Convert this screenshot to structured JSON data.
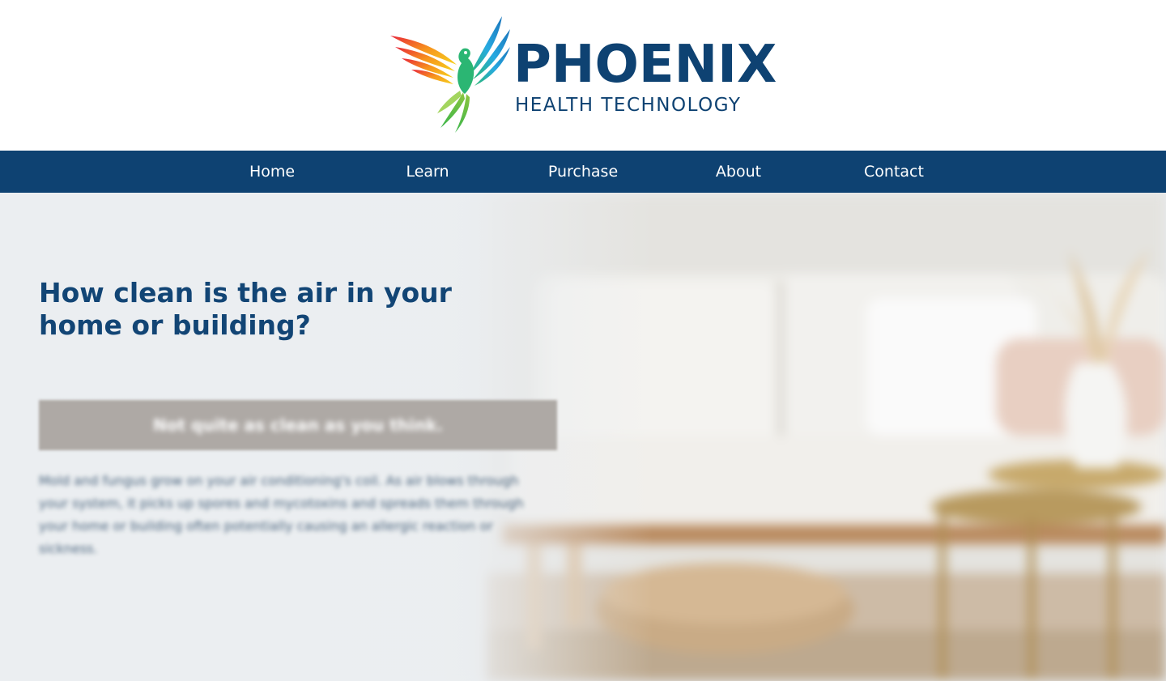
{
  "brand": {
    "title": "PHOENIX",
    "subtitle": "HEALTH TECHNOLOGY",
    "primary_color": "#0e4272",
    "logo_mark": "phoenix-bird-icon"
  },
  "nav": {
    "items": [
      {
        "label": "Home"
      },
      {
        "label": "Learn"
      },
      {
        "label": "Purchase"
      },
      {
        "label": "About"
      },
      {
        "label": "Contact"
      }
    ]
  },
  "hero": {
    "heading": "How clean is the air in your home or building?",
    "callout": "Not quite as clean as you think.",
    "callout_color": "#aea9a5",
    "body": "Mold and fungus grow on your air conditioning's coil. As air blows through your system, it picks up spores and mycotoxins and spreads them through your home or building often potentially causing an allergic reaction or sickness."
  }
}
